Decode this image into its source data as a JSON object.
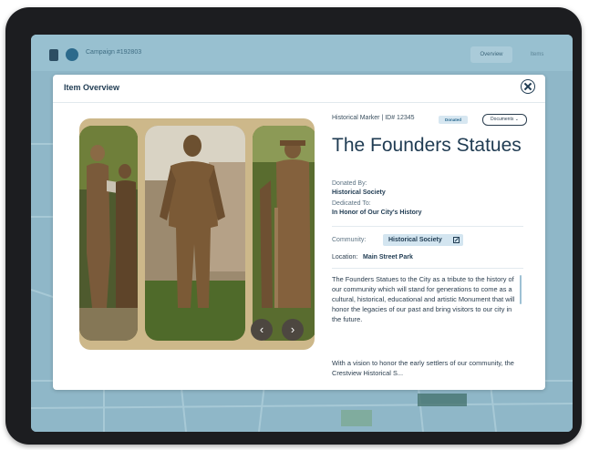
{
  "background_app": {
    "campaign": "Campaign #192803",
    "tabs": [
      "Overview",
      "Items"
    ]
  },
  "modal": {
    "title": "Item Overview"
  },
  "item": {
    "meta": "Historical Marker | ID# 12345",
    "status_badge": "Donated",
    "documents_button": "Documents",
    "title": "The Founders Statues",
    "donated_by_label": "Donated By:",
    "donated_by": "Historical Society",
    "dedicated_to_label": "Dedicated To:",
    "dedicated_to": "In Honor of Our City's History",
    "community_label": "Community:",
    "community": "Historical Society",
    "location_label": "Location:",
    "location": "Main Street Park",
    "description_1": "The Founders Statues to the City as a tribute to the history of our community which will stand for generations to come as a cultural, historical, educational and artistic Monument that will honor the legacies of our past and bring visitors to our city in the future.",
    "description_2": "With a vision to honor the early settlers of our community, the Crestview Historical S..."
  },
  "gallery": {
    "prev": "‹",
    "next": "›"
  },
  "colors": {
    "accent": "#1f3b52",
    "screen_bg": "#8fb7c8",
    "badge_bg": "#d3e5f0"
  }
}
